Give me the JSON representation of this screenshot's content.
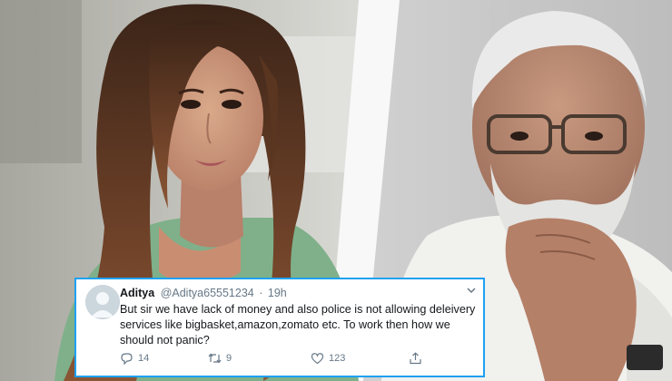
{
  "tweet": {
    "display_name": "Aditya",
    "handle": "@Aditya65551234",
    "separator": "·",
    "time": "19h",
    "text": "But sir we have lack of money and also police is not allowing deleivery services like bigbasket,amazon,zomato etc. To work then how we should not panic?",
    "reply_count": "14",
    "retweet_count": "9",
    "like_count": "123"
  },
  "icons": [
    "avatar-default-icon",
    "chevron-down-icon",
    "reply-icon",
    "retweet-icon",
    "like-icon",
    "share-icon"
  ],
  "colors": {
    "tweet_border": "#1da1f2",
    "muted_text": "#657786",
    "primary_text": "#14171a"
  }
}
